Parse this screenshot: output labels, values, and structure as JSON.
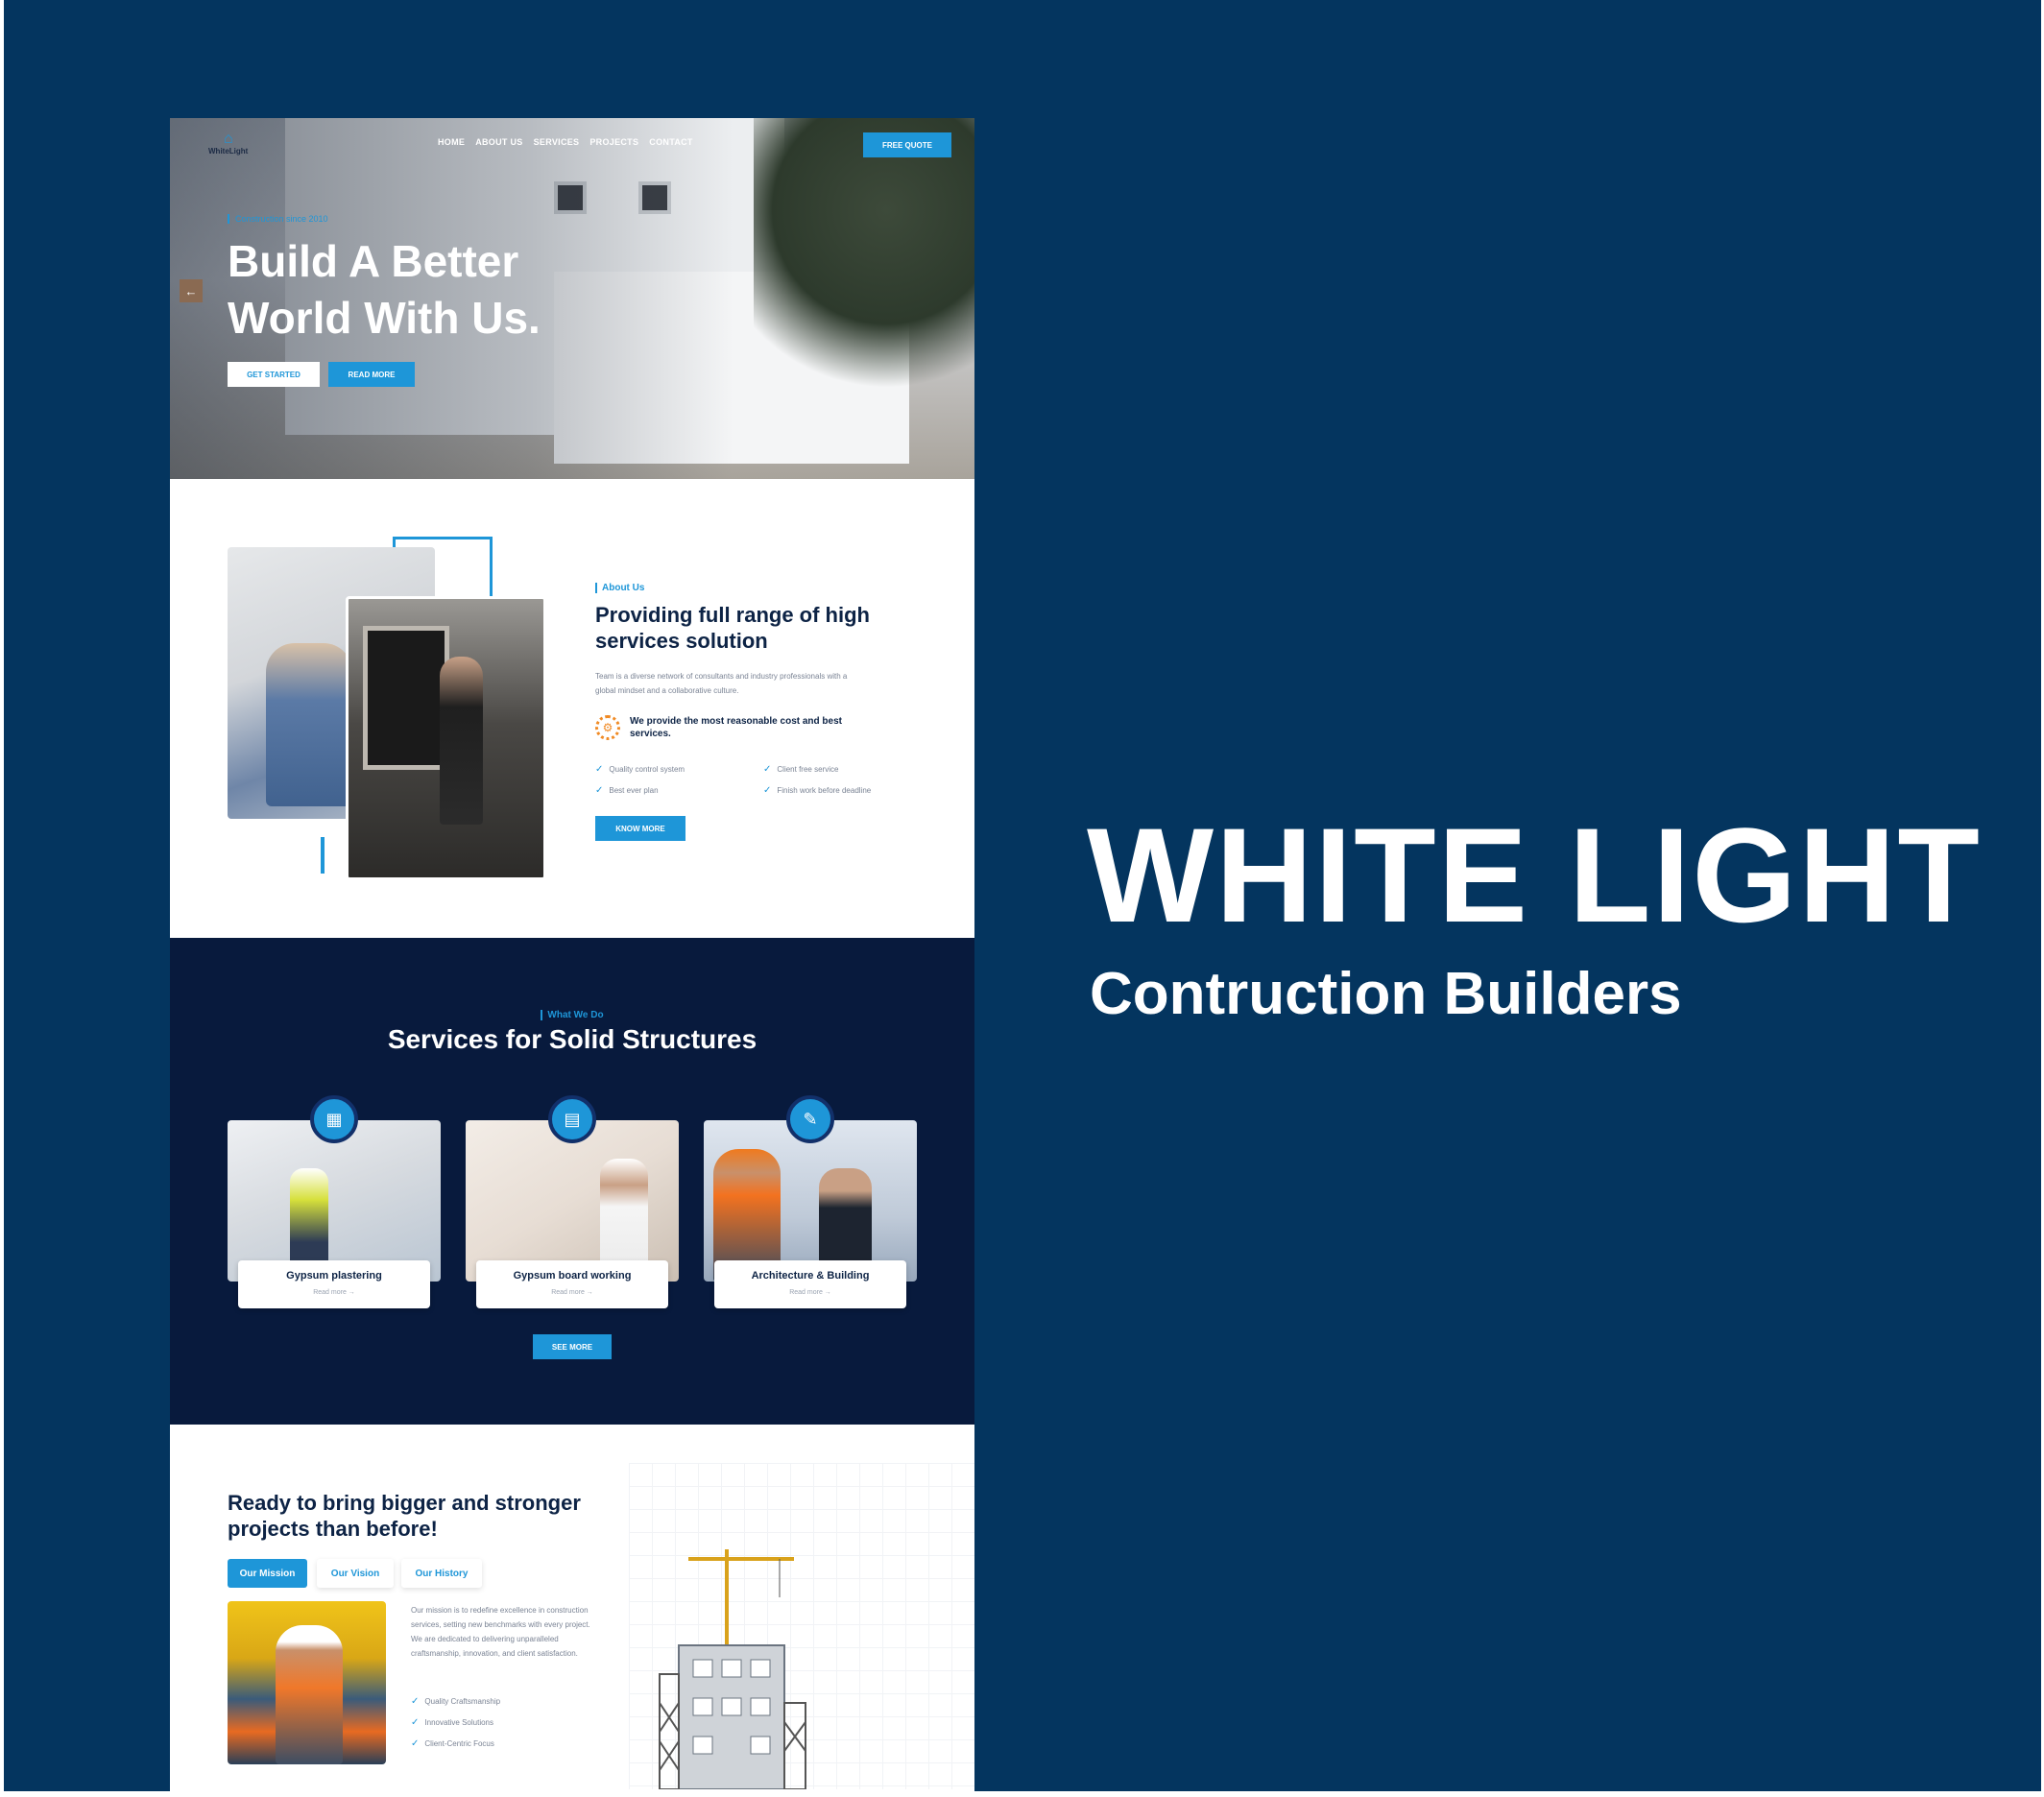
{
  "poster": {
    "title": "WHITE LIGHT",
    "subtitle": "Contruction Builders"
  },
  "header": {
    "logo_text": "WhiteLight",
    "nav": [
      "HOME",
      "ABOUT US",
      "SERVICES",
      "PROJECTS",
      "CONTACT"
    ],
    "cta_label": "FREE QUOTE"
  },
  "hero": {
    "tagline": "Construction since 2010",
    "title": "Build A Better World With Us.",
    "primary_label": "GET STARTED",
    "secondary_label": "READ MORE",
    "prev_icon": "arrow-left-icon"
  },
  "about": {
    "tag": "About Us",
    "title": "Providing full range of high services solution",
    "text": "Team is a diverse network of consultants and industry professionals with a global mindset and a collaborative culture.",
    "highlight": "We provide the most reasonable cost and best services.",
    "features": [
      "Quality control system",
      "Client free service",
      "Best ever plan",
      "Finish work before deadline"
    ],
    "button_label": "KNOW MORE"
  },
  "services": {
    "tag": "What We Do",
    "title": "Services for Solid Structures",
    "cards": [
      {
        "name": "Gypsum plastering",
        "link": "Read more",
        "icon": "crane-blueprint-icon"
      },
      {
        "name": "Gypsum board working",
        "link": "Read more",
        "icon": "building-plan-icon"
      },
      {
        "name": "Architecture & Building",
        "link": "Read more",
        "icon": "contract-icon"
      }
    ],
    "button_label": "SEE MORE"
  },
  "cta": {
    "title": "Ready to bring bigger and stronger projects than before!",
    "tabs": [
      "Our Mission",
      "Our Vision",
      "Our History"
    ],
    "active_tab": "Our Mission",
    "text": "Our mission is to redefine excellence in construction services, setting new benchmarks with every project. We are dedicated to delivering unparalleled craftsmanship, innovation, and client satisfaction.",
    "features": [
      "Quality Craftsmanship",
      "Innovative Solutions",
      "Client-Centric Focus"
    ]
  },
  "colors": {
    "background": "#04355f",
    "accent": "#1e96d8",
    "services_bg": "#081a3d",
    "heading": "#0d2345"
  }
}
